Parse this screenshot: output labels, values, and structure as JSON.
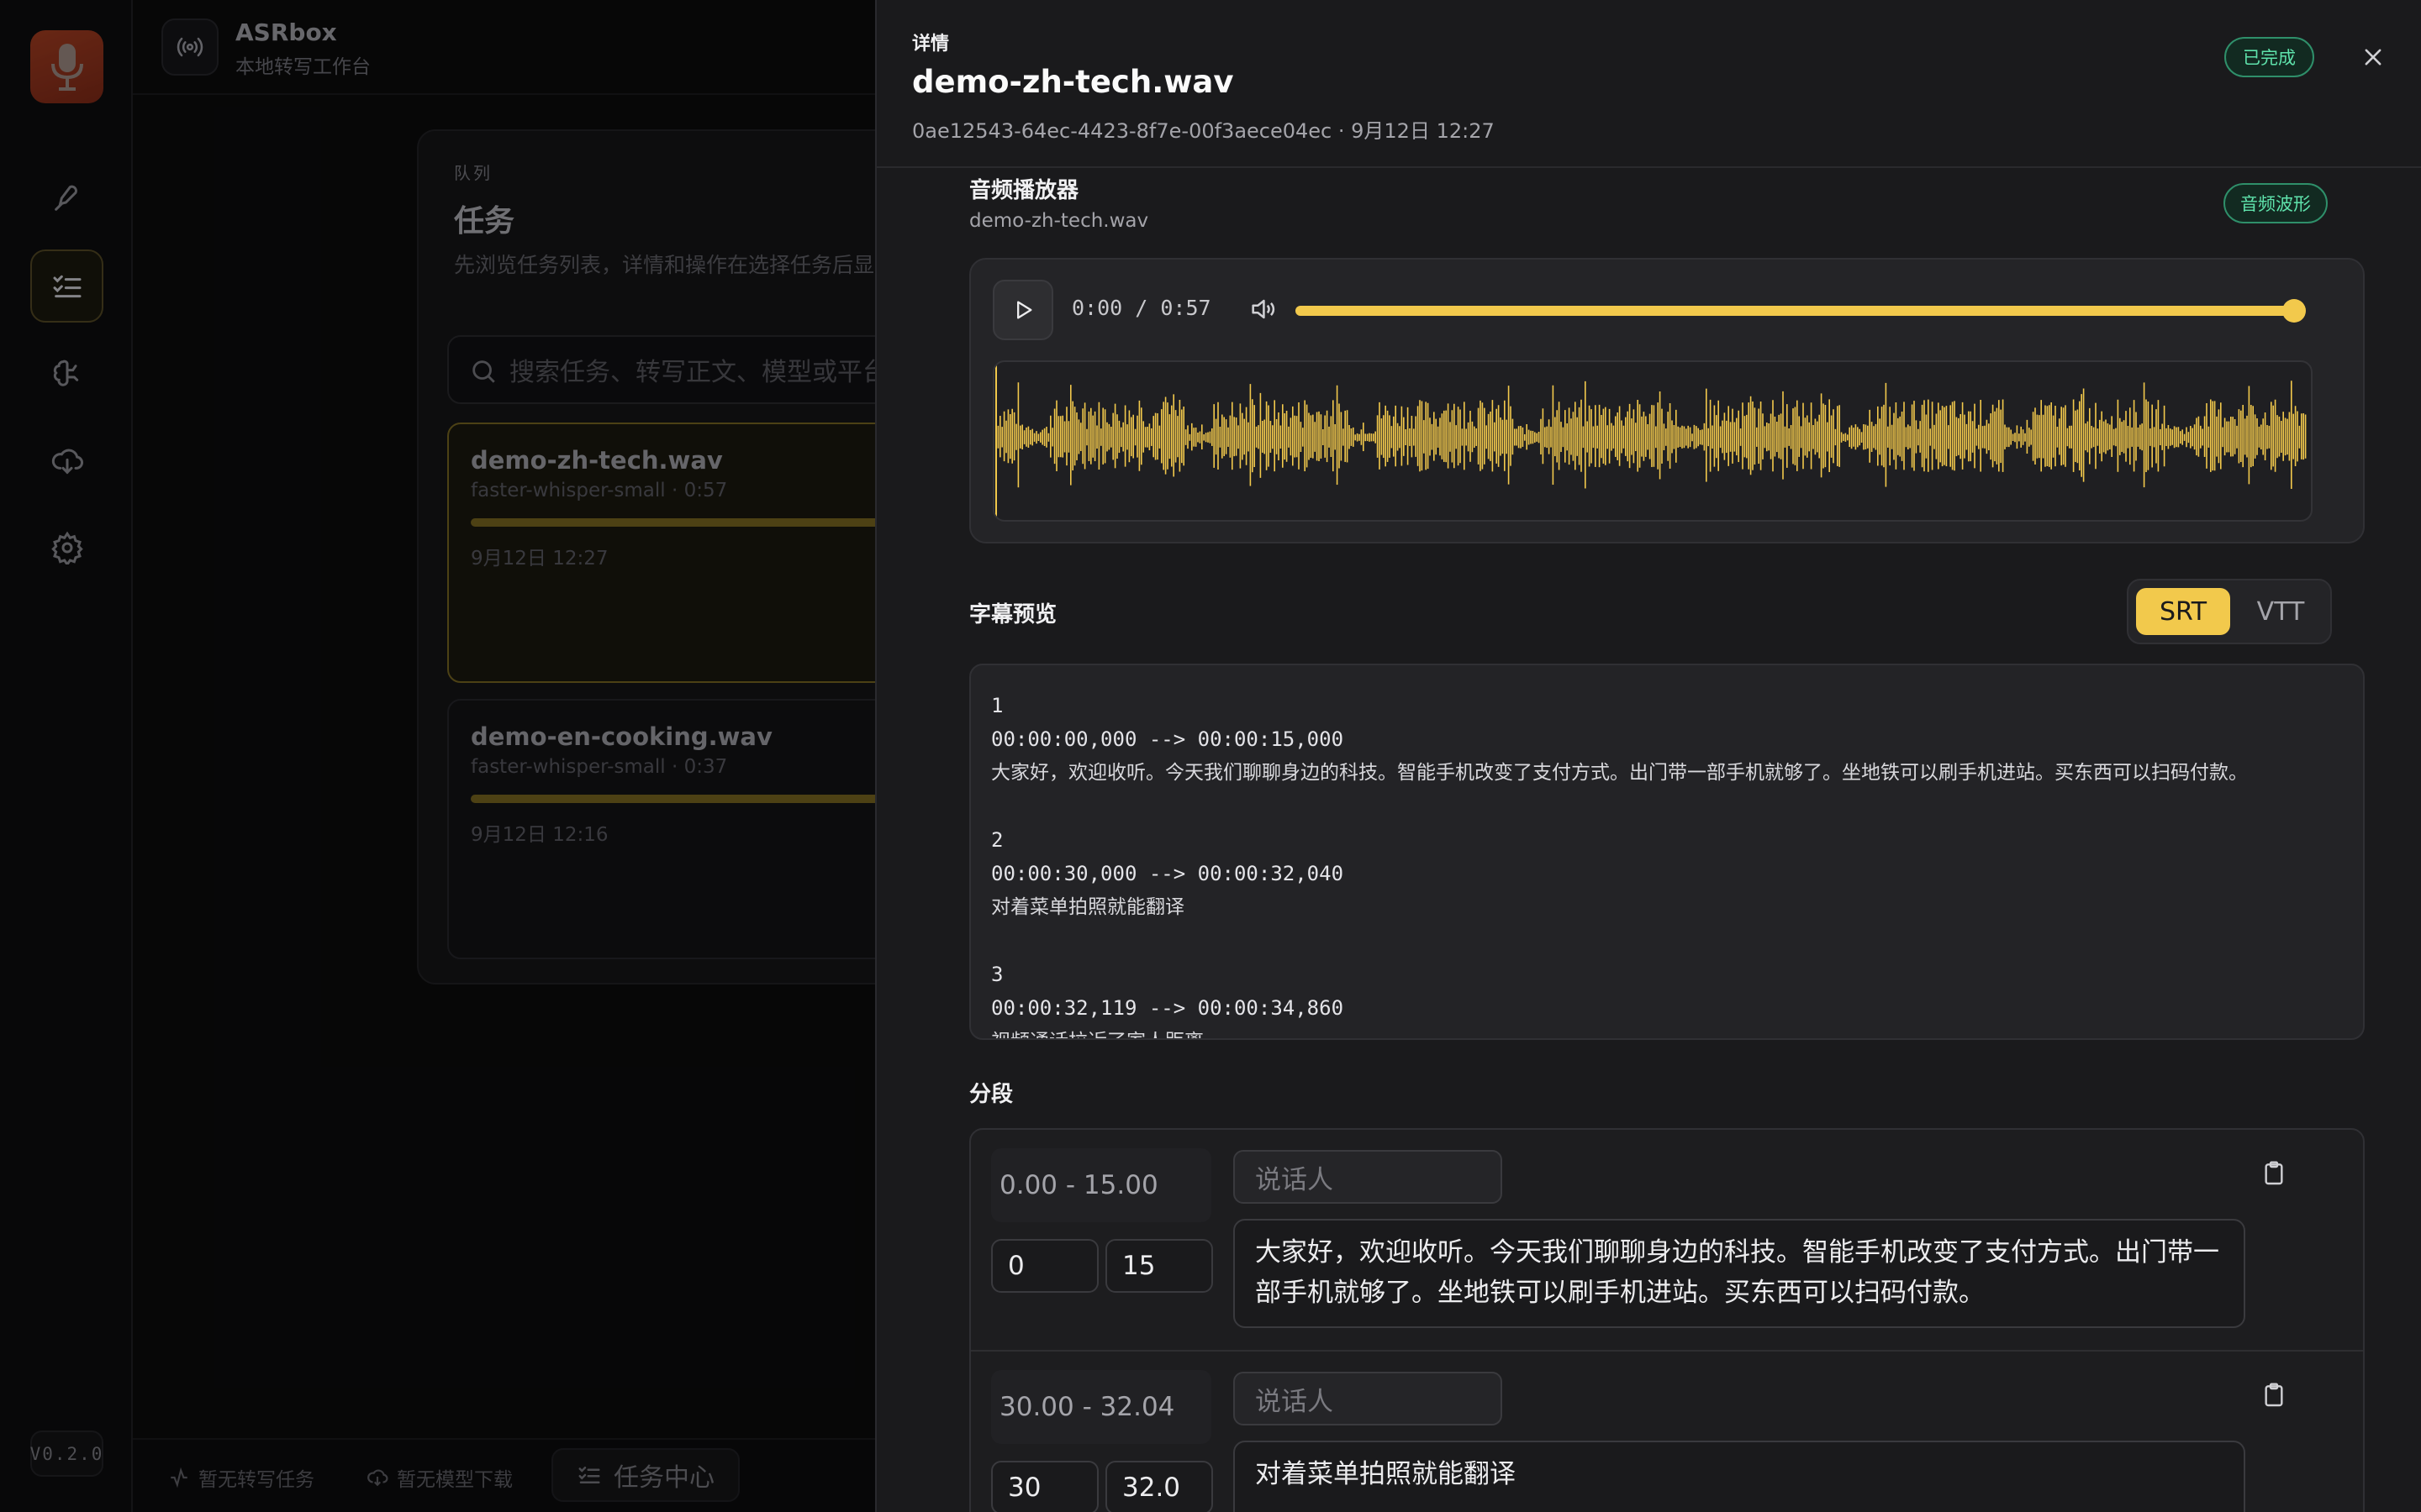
{
  "app": {
    "name": "ASRbox",
    "subtitle": "本地转写工作台",
    "version": "V0.2.0"
  },
  "tasks_panel": {
    "kicker": "队列",
    "title": "任务",
    "description": "先浏览任务列表，详情和操作在选择任务后显示",
    "search_placeholder": "搜索任务、转写正文、模型或平台",
    "items": [
      {
        "name": "demo-zh-tech.wav",
        "meta": "faster-whisper-small · 0:57",
        "date": "9月12日 12:27",
        "progress": 1.0,
        "selected": true
      },
      {
        "name": "demo-en-cooking.wav",
        "meta": "faster-whisper-small · 0:37",
        "date": "9月12日 12:16",
        "progress": 1.0,
        "selected": false
      }
    ]
  },
  "statusbar": {
    "transcribe": "暂无转写任务",
    "download": "暂无模型下载",
    "task_center": "任务中心"
  },
  "detail": {
    "kicker": "详情",
    "title": "demo-zh-tech.wav",
    "meta": "0ae12543-64ec-4423-8f7e-00f3aece04ec · 9月12日 12:27",
    "status_badge": "已完成",
    "player": {
      "title": "音频播放器",
      "filename": "demo-zh-tech.wav",
      "badge": "音频波形",
      "time": "0:00 / 0:57",
      "progress": 1.0,
      "waveform_color": "#f2c94c"
    },
    "subtitles": {
      "title": "字幕预览",
      "formats": [
        "SRT",
        "VTT"
      ],
      "active_format": "SRT",
      "cues": [
        {
          "index": "1",
          "time": "00:00:00,000 --> 00:00:15,000",
          "text": "大家好，欢迎收听。今天我们聊聊身边的科技。智能手机改变了支付方式。出门带一部手机就够了。坐地铁可以刷手机进站。买东西可以扫码付款。"
        },
        {
          "index": "2",
          "time": "00:00:30,000 --> 00:00:32,040",
          "text": "对着菜单拍照就能翻译"
        },
        {
          "index": "3",
          "time": "00:00:32,119 --> 00:00:34,860",
          "text": "视频通话拉近了家人距离"
        }
      ]
    },
    "segments": {
      "title": "分段",
      "speaker_placeholder": "说话人",
      "items": [
        {
          "range": "0.00 - 15.00",
          "start": "0",
          "end": "15",
          "text": "大家好，欢迎收听。今天我们聊聊身边的科技。智能手机改变了支付方式。出门带一部手机就够了。坐地铁可以刷手机进站。买东西可以扫码付款。"
        },
        {
          "range": "30.00 - 32.04",
          "start": "30",
          "end": "32.0",
          "text": "对着菜单拍照就能翻译"
        }
      ]
    }
  },
  "colors": {
    "accent": "#f2c94c",
    "success": "#5fe3ac",
    "background": "#0a0a0b",
    "drawer": "#1a1a1c"
  }
}
